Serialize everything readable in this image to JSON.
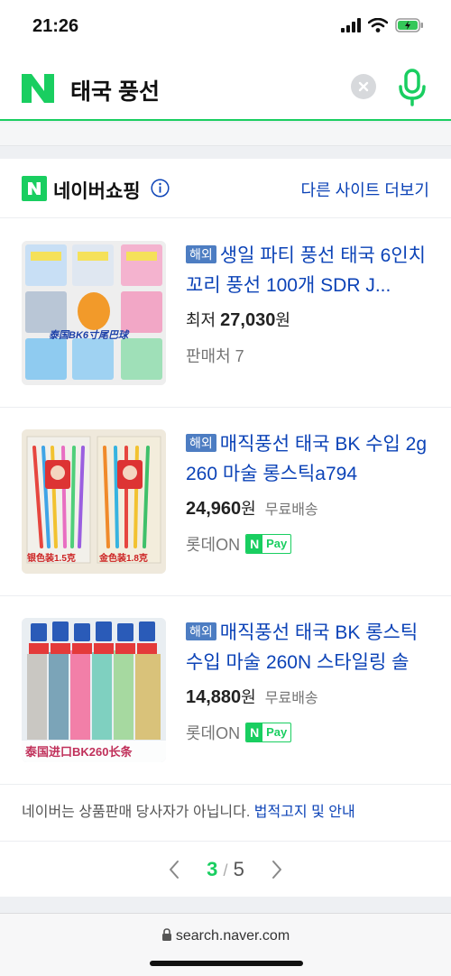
{
  "status": {
    "time": "21:26"
  },
  "search": {
    "query": "태국 풍선"
  },
  "shopping": {
    "title": "네이버쇼핑",
    "more_label": "다른 사이트 더보기",
    "items": [
      {
        "badge": "해외",
        "title": "생일 파티 풍선 태국 6인치 꼬리 풍선 100개 SDR J...",
        "price_prefix": "최저",
        "price": "27,030",
        "unit": "원",
        "shipping": "",
        "seller": "판매처 7",
        "thumb_caption": "泰国BK6寸尾巴球"
      },
      {
        "badge": "해외",
        "title": "매직풍선 태국 BK 수입 2g 260 마술 롱스틱a794",
        "price_prefix": "",
        "price": "24,960",
        "unit": "원",
        "shipping": "무료배송",
        "seller": "롯데ON",
        "npay": "Pay",
        "thumb_caption_left": "银色装1.5克",
        "thumb_caption_right": "金色装1.8克"
      },
      {
        "badge": "해외",
        "title": "매직풍선 태국 BK 롱스틱 수입 마술 260N 스타일링 솔",
        "price_prefix": "",
        "price": "14,880",
        "unit": "원",
        "shipping": "무료배송",
        "seller": "롯데ON",
        "npay": "Pay",
        "thumb_caption": "泰国进口BK260长条"
      }
    ],
    "notice_text": "네이버는 상품판매 당사자가 아닙니다.",
    "notice_link": "법적고지 및 안내"
  },
  "pagination": {
    "current": "3",
    "separator": "/",
    "total": "5"
  },
  "browser": {
    "url": "search.naver.com"
  },
  "colors": {
    "naver_green": "#19ce60",
    "link_blue": "#0c43b7",
    "badge_blue": "#4d7dc2"
  },
  "icons": [
    "signal-icon",
    "wifi-icon",
    "battery-icon",
    "clear-icon",
    "mic-icon",
    "info-icon",
    "chevron-left-icon",
    "chevron-right-icon",
    "lock-icon"
  ]
}
